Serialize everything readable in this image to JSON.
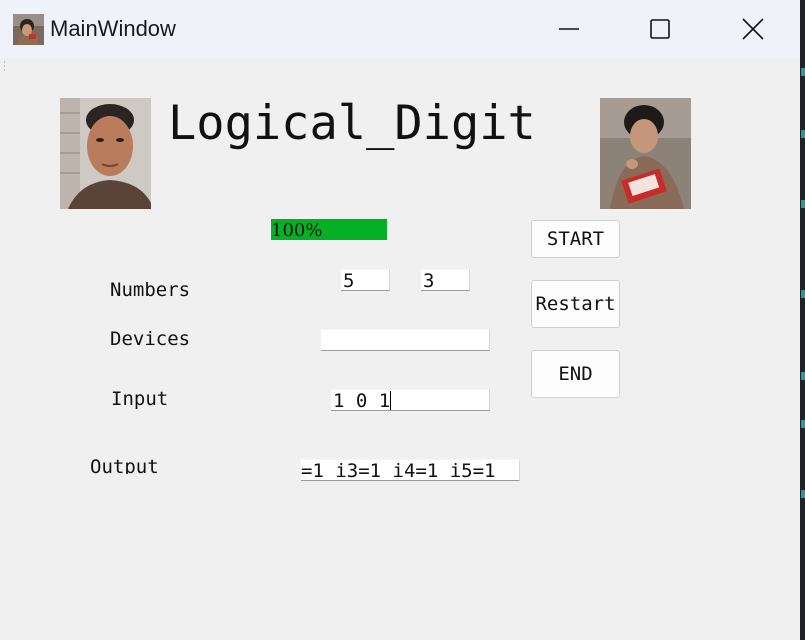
{
  "window": {
    "title": "MainWindow"
  },
  "header": {
    "title": "Logical_Digit"
  },
  "progress": {
    "value": 1.0,
    "label": "100%",
    "color": "#06b025"
  },
  "form": {
    "numbers_label": "Numbers",
    "numbers_a": "5",
    "numbers_b": "3",
    "devices_label": "Devices",
    "devices_value": "",
    "input_label": "Input",
    "input_value": "1 0 1",
    "output_label": "Output",
    "output_value": "=1 i3=1 i4=1 i5=1"
  },
  "buttons": {
    "start": "START",
    "restart": "Restart",
    "end": "END"
  },
  "icons": {
    "minimize": "minimize-icon",
    "maximize": "maximize-icon",
    "close": "close-icon"
  }
}
